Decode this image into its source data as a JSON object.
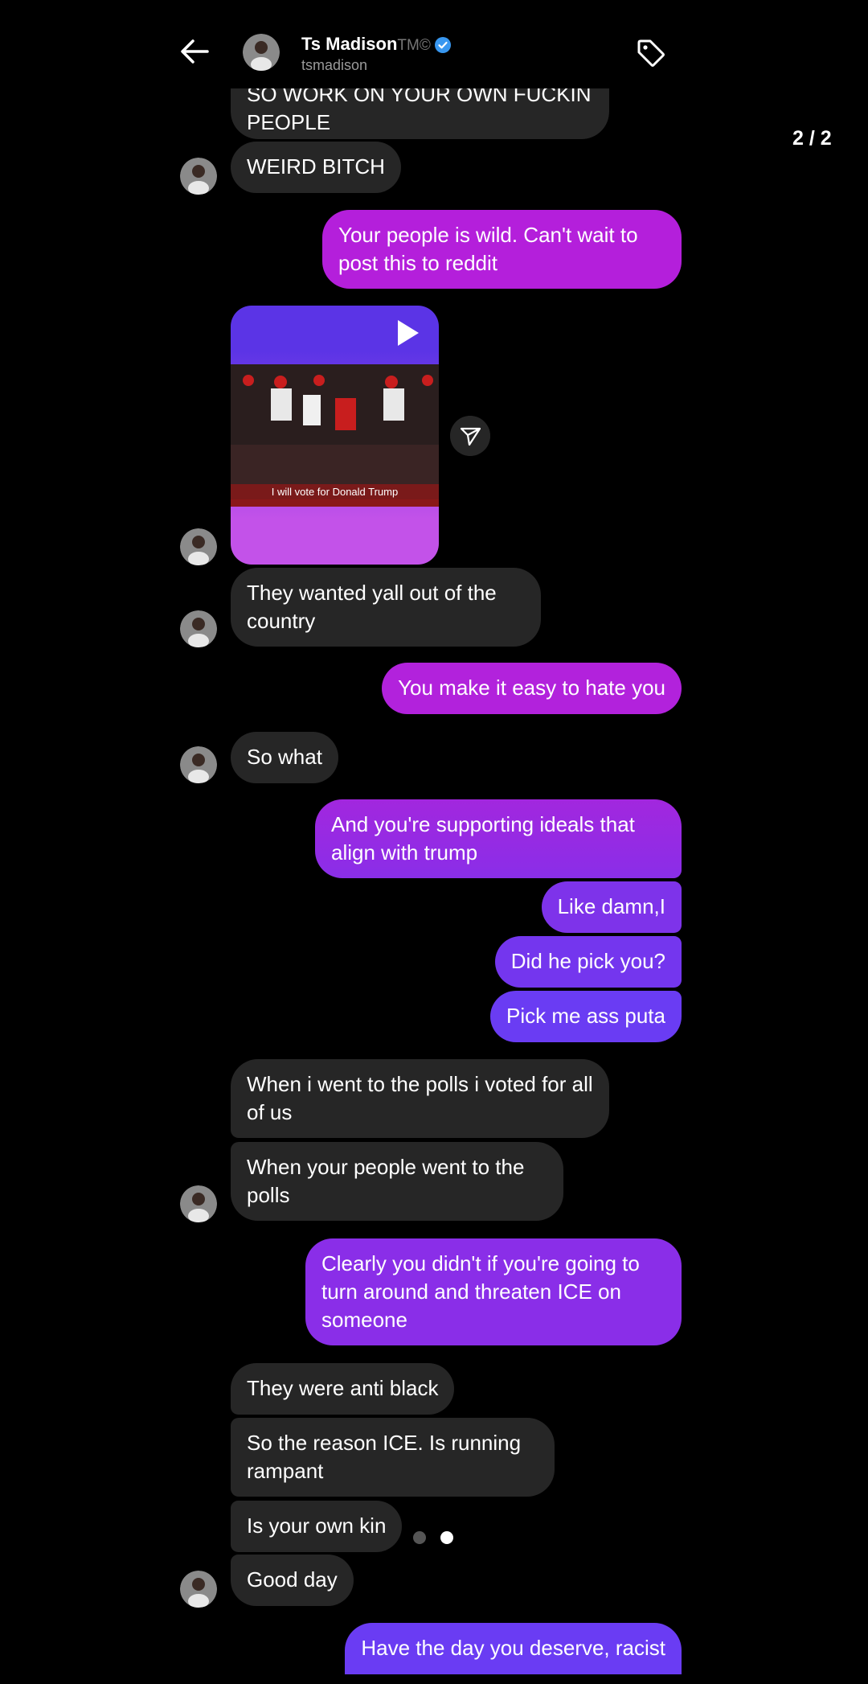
{
  "header": {
    "name": "Ts Madison",
    "name_suffix": "TM©",
    "username": "tsmadison",
    "page_indicator": "2 / 2"
  },
  "icons": {
    "back": "back-arrow-icon",
    "tag": "tag-icon",
    "verified": "verified-badge-icon",
    "play": "play-icon",
    "share": "share-icon"
  },
  "colors": {
    "incoming_bubble": "#262626",
    "outgoing_top": "#b41fdb",
    "outgoing_bottom": "#6a3cf3",
    "verified": "#3897f0"
  },
  "video": {
    "caption": "I will vote for Donald Trump"
  },
  "messages": [
    {
      "side": "in",
      "text": "SO WORK ON YOUR OWN FUCKIN PEOPLE"
    },
    {
      "side": "in",
      "text": "WEIRD BITCH"
    },
    {
      "side": "out",
      "text": "Your people is wild. Can't wait to post this to reddit"
    },
    {
      "side": "in",
      "text": "They wanted yall out of  the country"
    },
    {
      "side": "out",
      "text": "You make it easy to hate you"
    },
    {
      "side": "in",
      "text": "So what"
    },
    {
      "side": "out",
      "text": "And you're supporting ideals that align with trump"
    },
    {
      "side": "out",
      "text": "Like damn,I"
    },
    {
      "side": "out",
      "text": "Did he pick you?"
    },
    {
      "side": "out",
      "text": "Pick me ass puta"
    },
    {
      "side": "in",
      "text": "When i went to the polls i voted for all of us"
    },
    {
      "side": "in",
      "text": "When your people went to the polls"
    },
    {
      "side": "out",
      "text": "Clearly you didn't if you're going to turn around and threaten ICE on someone"
    },
    {
      "side": "in",
      "text": "They were anti black"
    },
    {
      "side": "in",
      "text": "So the reason ICE. Is running rampant"
    },
    {
      "side": "in",
      "text": "Is your own kin"
    },
    {
      "side": "in",
      "text": "Good day"
    },
    {
      "side": "out",
      "text": "Have the day you deserve, racist"
    }
  ]
}
